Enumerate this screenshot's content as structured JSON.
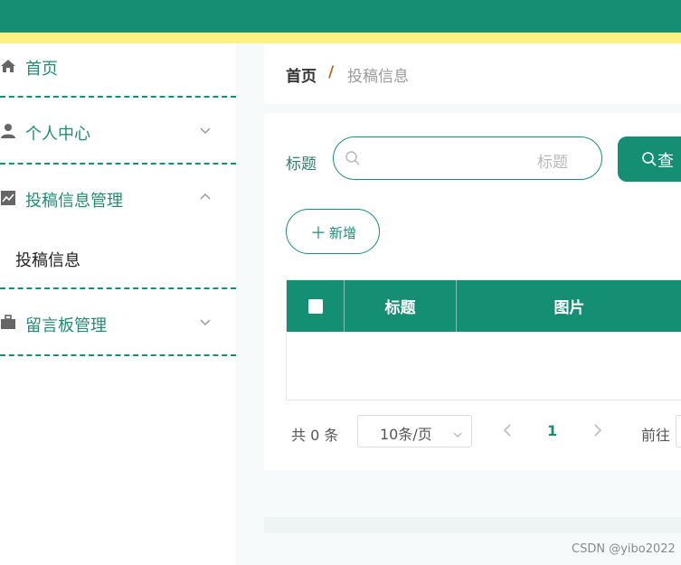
{
  "colors": {
    "primary": "#148f74",
    "header_stripe": "#fdf183",
    "accent_separator": "#d35a2b"
  },
  "sidebar": {
    "items": [
      {
        "label": "首页",
        "icon": "home-icon"
      },
      {
        "label": "个人中心",
        "icon": "user-icon",
        "chevron": "chevron-down-icon"
      },
      {
        "label": "投稿信息管理",
        "icon": "chart-icon",
        "chevron": "chevron-up-icon",
        "expanded": true
      },
      {
        "label": "留言板管理",
        "icon": "briefcase-icon",
        "chevron": "chevron-down-icon"
      }
    ],
    "subitems": [
      {
        "label": "投稿信息"
      }
    ]
  },
  "breadcrumb": {
    "home": "首页",
    "separator": "/",
    "current": "投稿信息"
  },
  "search": {
    "label": "标题",
    "placeholder": "标题",
    "query_button": "查"
  },
  "toolbar": {
    "add_label": "新增"
  },
  "table": {
    "columns": [
      "标题",
      "图片"
    ],
    "rows": []
  },
  "pagination": {
    "total_text": "共 0 条",
    "page_size": "10条/页",
    "current_page": "1",
    "goto_label": "前往"
  },
  "watermark": "CSDN @yibo2022"
}
